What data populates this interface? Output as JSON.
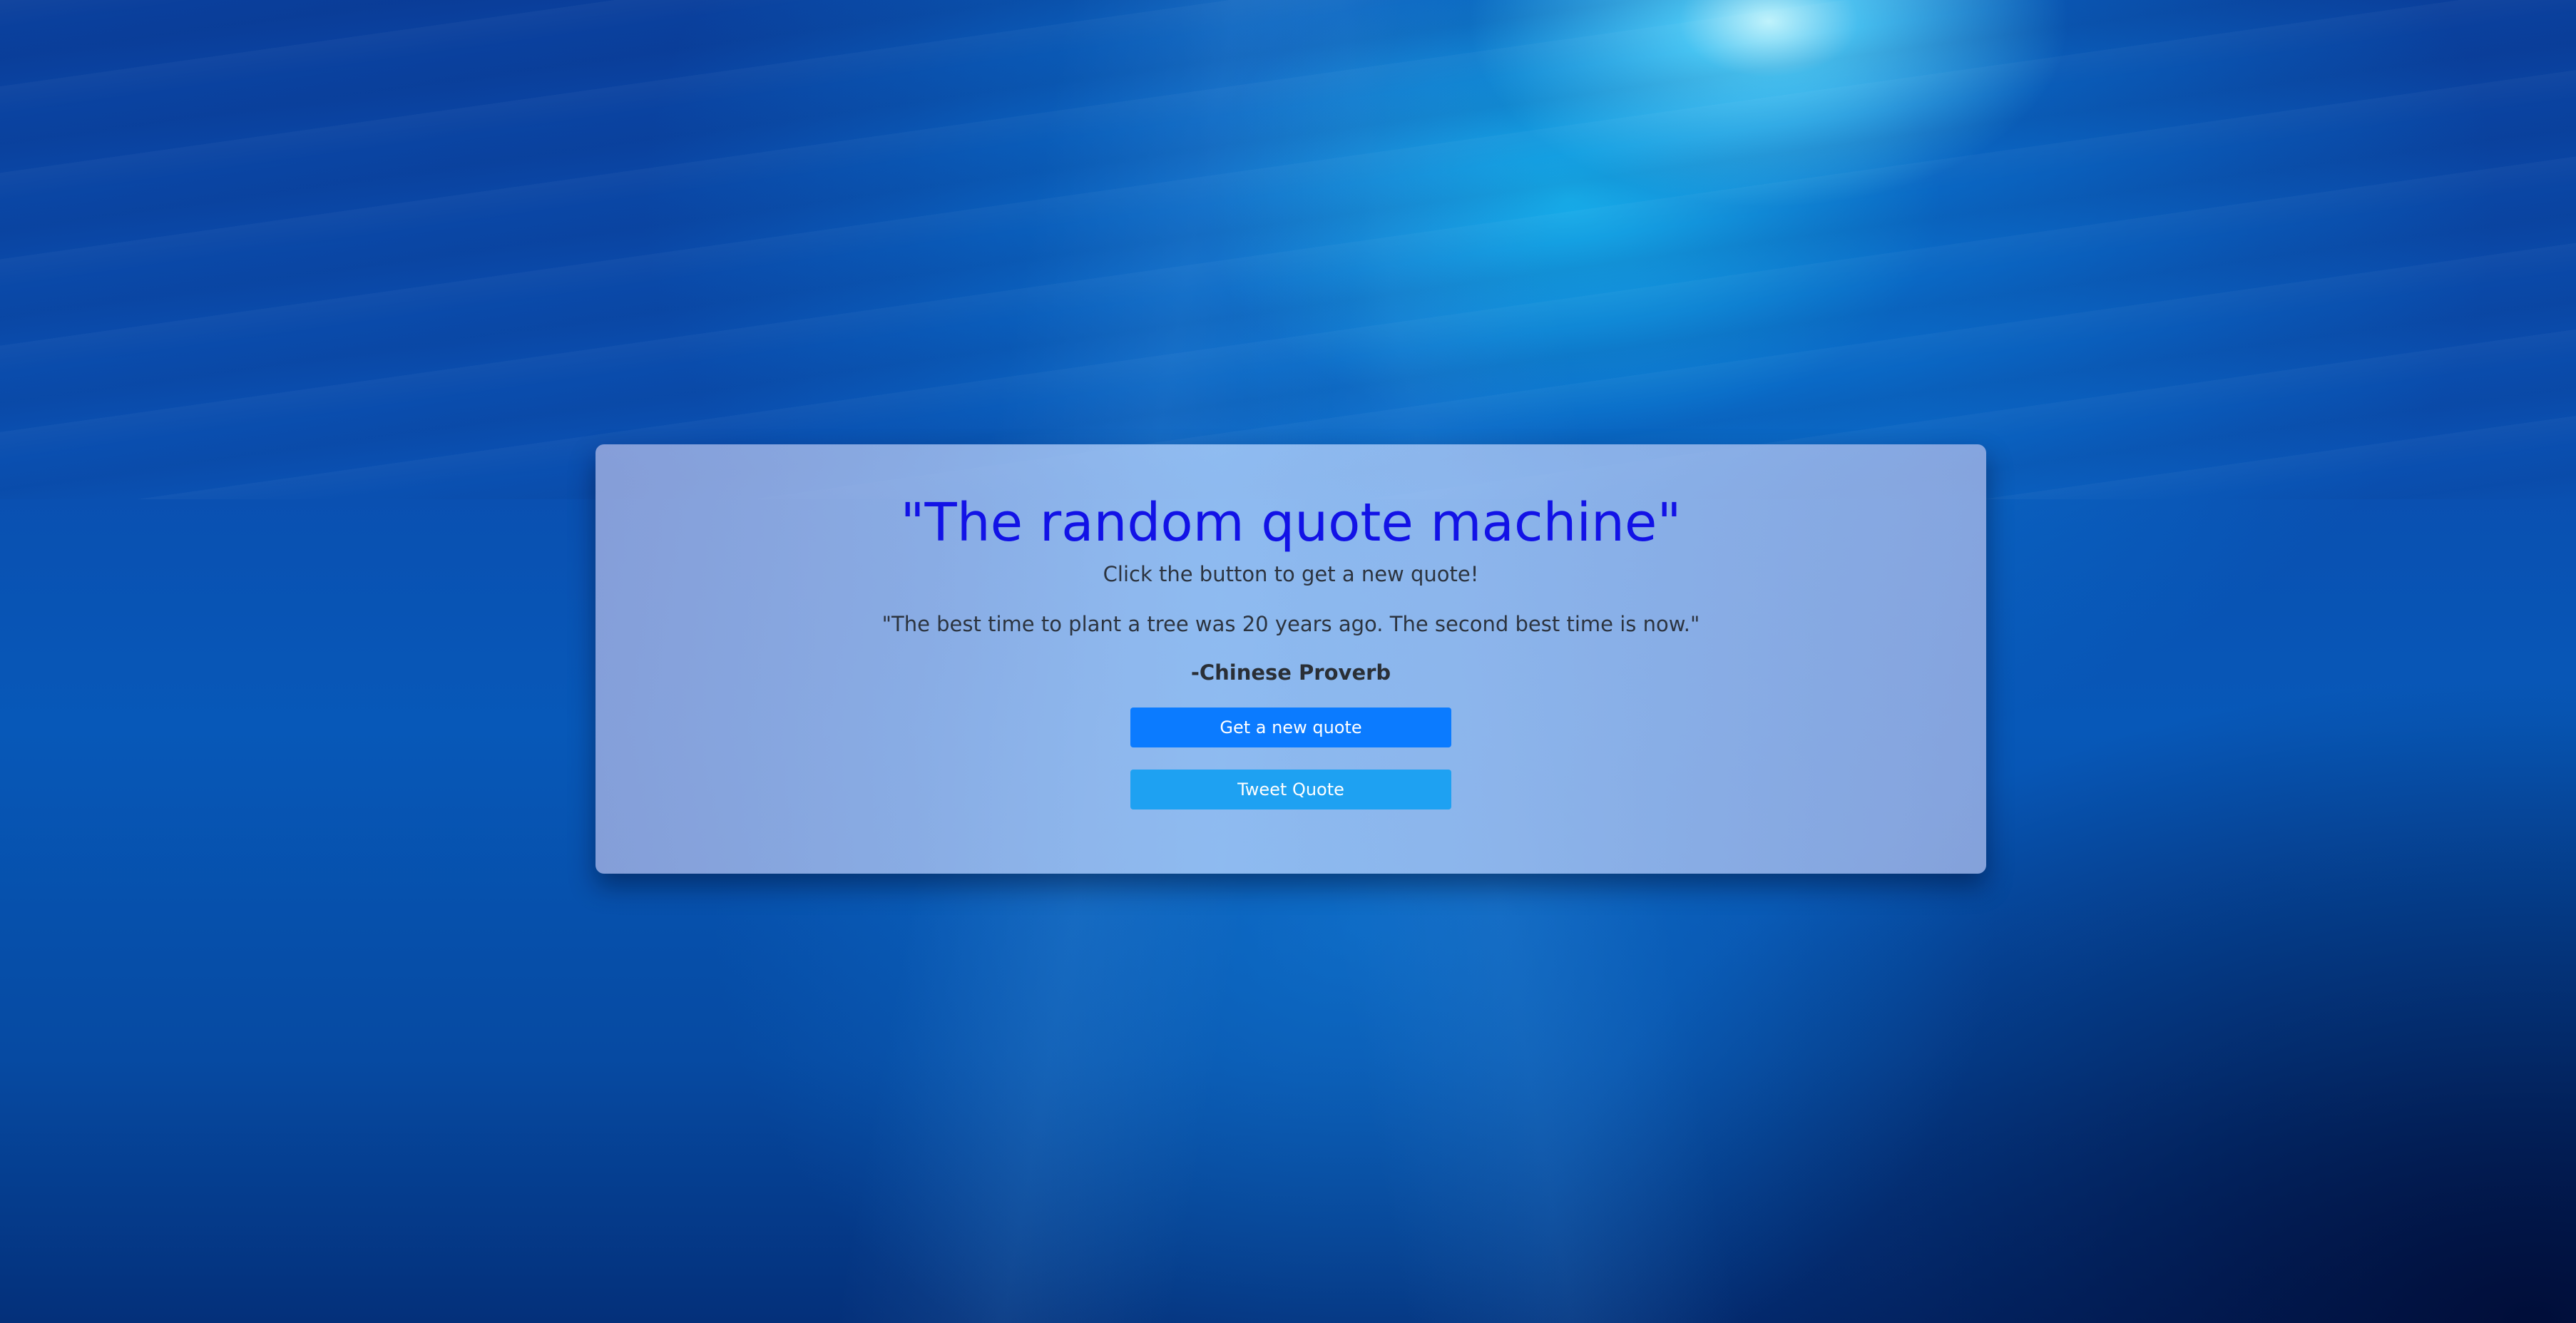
{
  "page": {
    "title": "\"The random quote machine\"",
    "subtitle": "Click the button to get a new quote!"
  },
  "quote": {
    "text": "\"The best time to plant a tree was 20 years ago. The second best time is now.\"",
    "author": "-Chinese Proverb"
  },
  "buttons": {
    "new_quote": "Get a new quote",
    "tweet": "Tweet Quote"
  },
  "colors": {
    "title": "#1212e6",
    "new_quote_button": "#0b7bff",
    "tweet_button": "#1ea1f2"
  }
}
